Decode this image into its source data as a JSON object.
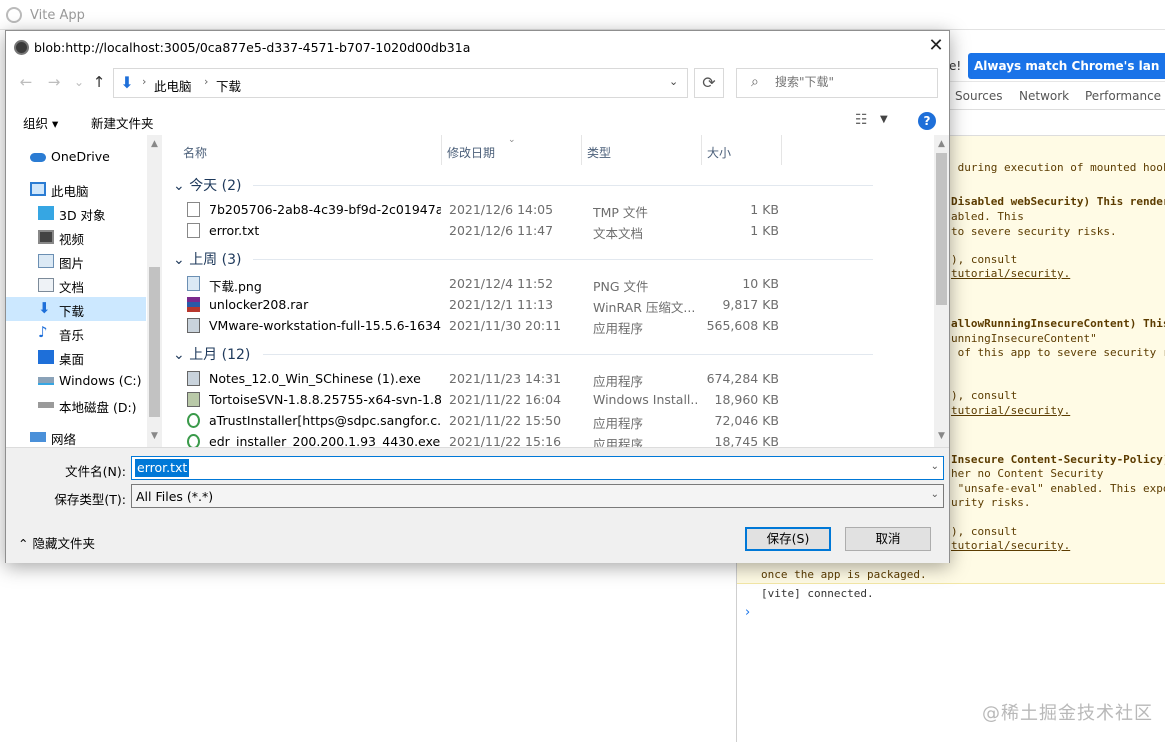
{
  "app": {
    "title": "Vite App"
  },
  "devtools": {
    "lang_trail": "e!",
    "lang_button": "Always match Chrome's language",
    "tabs": [
      "Sources",
      "Network",
      "Performance"
    ],
    "console_lines": [
      {
        "text": " during execution of mounted hook",
        "bold": false,
        "link": false
      },
      {
        "text": "Disabled webSecurity) This render",
        "bold": true,
        "link": false
      },
      {
        "text": "abled. This",
        "bold": false,
        "link": false
      },
      {
        "text": "to severe security risks.",
        "bold": false,
        "link": false
      },
      {
        "text": "), consult",
        "bold": false,
        "link": false
      },
      {
        "text": "tutorial/security.",
        "bold": false,
        "link": true
      },
      {
        "text": "allowRunningInsecureContent) This",
        "bold": true,
        "link": false
      },
      {
        "text": "unningInsecureContent\"",
        "bold": false,
        "link": false
      },
      {
        "text": " of this app to severe security r",
        "bold": false,
        "link": false
      },
      {
        "text": "), consult",
        "bold": false,
        "link": false
      },
      {
        "text": "tutorial/security.",
        "bold": false,
        "link": true
      },
      {
        "text": "Insecure Content-Security-Policy)",
        "bold": true,
        "link": false
      },
      {
        "text": "her no Content Security",
        "bold": false,
        "link": false
      },
      {
        "text": " \"unsafe-eval\" enabled. This expo",
        "bold": false,
        "link": false
      },
      {
        "text": "urity risks.",
        "bold": false,
        "link": false
      },
      {
        "text": "), consult",
        "bold": false,
        "link": false
      },
      {
        "text": "tutorial/security.",
        "bold": false,
        "link": true
      },
      {
        "text": "once the app is packaged.",
        "bold": false,
        "link": false
      }
    ],
    "console_connected": "[vite] connected.",
    "prompt": "›"
  },
  "watermark": "@稀土掘金技术社区",
  "dialog": {
    "title": "blob:http://localhost:3005/0ca877e5-d337-4571-b707-1020d00db31a",
    "close": "✕",
    "nav": {
      "back": "←",
      "forward": "→",
      "down": "⌄",
      "up": "↑"
    },
    "breadcrumb": [
      "此电脑",
      "下载"
    ],
    "refresh": "⟳",
    "search_placeholder": "搜索\"下载\"",
    "toolbar": {
      "organize": "组织 ▾",
      "new_folder": "新建文件夹",
      "help": "?"
    },
    "nav_pane": [
      {
        "label": "OneDrive",
        "icon": "onedrive-icon",
        "selected": false
      },
      {
        "label": "此电脑",
        "icon": "computer-icon",
        "selected": false
      },
      {
        "label": "3D 对象",
        "icon": "cube-icon",
        "selected": false
      },
      {
        "label": "视频",
        "icon": "video-icon",
        "selected": false
      },
      {
        "label": "图片",
        "icon": "picture-icon",
        "selected": false
      },
      {
        "label": "文档",
        "icon": "document-icon",
        "selected": false
      },
      {
        "label": "下载",
        "icon": "download-icon",
        "selected": true
      },
      {
        "label": "音乐",
        "icon": "music-icon",
        "selected": false
      },
      {
        "label": "桌面",
        "icon": "desktop-icon",
        "selected": false
      },
      {
        "label": "Windows (C:)",
        "icon": "drive-icon",
        "selected": false
      },
      {
        "label": "本地磁盘 (D:)",
        "icon": "drive-icon",
        "selected": false
      },
      {
        "label": "网络",
        "icon": "network-icon",
        "selected": false
      }
    ],
    "columns": [
      "名称",
      "修改日期",
      "类型",
      "大小"
    ],
    "groups": [
      {
        "label": "今天 (2)",
        "files": [
          {
            "name": "7b205706-2ab8-4c39-bf9d-2c01947a...",
            "date": "2021/12/6 14:05",
            "type": "TMP 文件",
            "size": "1 KB",
            "icon": "file-icon"
          },
          {
            "name": "error.txt",
            "date": "2021/12/6 11:47",
            "type": "文本文档",
            "size": "1 KB",
            "icon": "text-file-icon"
          }
        ]
      },
      {
        "label": "上周 (3)",
        "files": [
          {
            "name": "下载.png",
            "date": "2021/12/4 11:52",
            "type": "PNG 文件",
            "size": "10 KB",
            "icon": "image-file-icon"
          },
          {
            "name": "unlocker208.rar",
            "date": "2021/12/1 11:13",
            "type": "WinRAR 压缩文...",
            "size": "9,817 KB",
            "icon": "rar-icon"
          },
          {
            "name": "VMware-workstation-full-15.5.6-1634...",
            "date": "2021/11/30 20:11",
            "type": "应用程序",
            "size": "565,608 KB",
            "icon": "exe-icon"
          }
        ]
      },
      {
        "label": "上月 (12)",
        "files": [
          {
            "name": "Notes_12.0_Win_SChinese (1).exe",
            "date": "2021/11/23 14:31",
            "type": "应用程序",
            "size": "674,284 KB",
            "icon": "exe-icon"
          },
          {
            "name": "TortoiseSVN-1.8.8.25755-x64-svn-1.8....",
            "date": "2021/11/22 16:04",
            "type": "Windows Install...",
            "size": "18,960 KB",
            "icon": "installer-icon"
          },
          {
            "name": "aTrustInstaller[https@sdpc.sangfor.c...",
            "date": "2021/11/22 15:50",
            "type": "应用程序",
            "size": "72,046 KB",
            "icon": "exe-icon"
          },
          {
            "name": "edr_installer_200.200.1.93_4430.exe",
            "date": "2021/11/22 15:16",
            "type": "应用程序",
            "size": "18,745 KB",
            "icon": "exe-icon"
          }
        ]
      }
    ],
    "filename_label": "文件名(N):",
    "filename_value": "error.txt",
    "filetype_label": "保存类型(T):",
    "filetype_value": "All Files (*.*)",
    "hide_folders": "隐藏文件夹",
    "save": "保存(S)",
    "cancel": "取消",
    "colors": {
      "accent": "#0078d7",
      "selection": "#cce8ff",
      "group": "#1e395b"
    }
  }
}
